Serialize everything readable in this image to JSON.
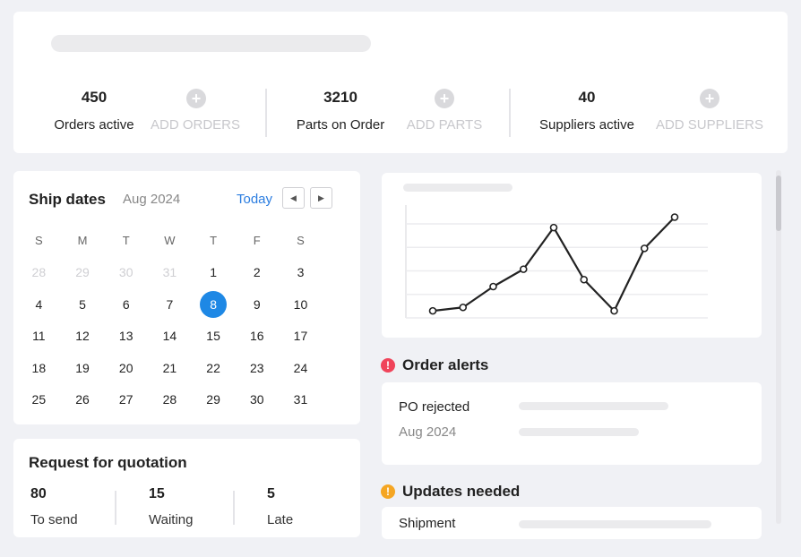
{
  "stats": {
    "orders": {
      "value": "450",
      "label": "Orders active",
      "add_label": "ADD ORDERS"
    },
    "parts": {
      "value": "3210",
      "label": "Parts on Order",
      "add_label": "ADD PARTS"
    },
    "suppliers": {
      "value": "40",
      "label": "Suppliers active",
      "add_label": "ADD SUPPLIERS"
    },
    "add_icon": "+"
  },
  "calendar": {
    "title": "Ship dates",
    "month": "Aug 2024",
    "today_label": "Today",
    "prev_icon": "◀",
    "next_icon": "▶",
    "weekdays": [
      "S",
      "M",
      "T",
      "W",
      "T",
      "F",
      "S"
    ],
    "weeks": [
      [
        {
          "d": "28",
          "muted": true
        },
        {
          "d": "29",
          "muted": true
        },
        {
          "d": "30",
          "muted": true
        },
        {
          "d": "31",
          "muted": true
        },
        {
          "d": "1"
        },
        {
          "d": "2"
        },
        {
          "d": "3"
        }
      ],
      [
        {
          "d": "4"
        },
        {
          "d": "5"
        },
        {
          "d": "6"
        },
        {
          "d": "7"
        },
        {
          "d": "8",
          "selected": true
        },
        {
          "d": "9"
        },
        {
          "d": "10"
        }
      ],
      [
        {
          "d": "11"
        },
        {
          "d": "12"
        },
        {
          "d": "13"
        },
        {
          "d": "14"
        },
        {
          "d": "15"
        },
        {
          "d": "16"
        },
        {
          "d": "17"
        }
      ],
      [
        {
          "d": "18"
        },
        {
          "d": "19"
        },
        {
          "d": "20"
        },
        {
          "d": "21"
        },
        {
          "d": "22"
        },
        {
          "d": "23"
        },
        {
          "d": "24"
        }
      ],
      [
        {
          "d": "25"
        },
        {
          "d": "26"
        },
        {
          "d": "27"
        },
        {
          "d": "28"
        },
        {
          "d": "29"
        },
        {
          "d": "30"
        },
        {
          "d": "31"
        }
      ]
    ],
    "selected_color": "#1e88e5"
  },
  "rfq": {
    "title": "Request for quotation",
    "items": [
      {
        "value": "80",
        "label": "To send"
      },
      {
        "value": "15",
        "label": "Waiting"
      },
      {
        "value": "5",
        "label": "Late"
      }
    ]
  },
  "chart_data": {
    "type": "line",
    "values": [
      0.5,
      1.0,
      4.0,
      6.5,
      12.5,
      5.0,
      0.5,
      9.5,
      14.0
    ],
    "ylim": [
      0,
      16
    ],
    "grid": true
  },
  "alerts": {
    "title": "Order alerts",
    "icon": "!",
    "icon_color": "#f0445a",
    "row_label": "PO rejected",
    "row_sub": "Aug 2024"
  },
  "updates": {
    "title": "Updates needed",
    "icon": "!",
    "icon_color": "#f5a623",
    "row_label": "Shipment"
  }
}
